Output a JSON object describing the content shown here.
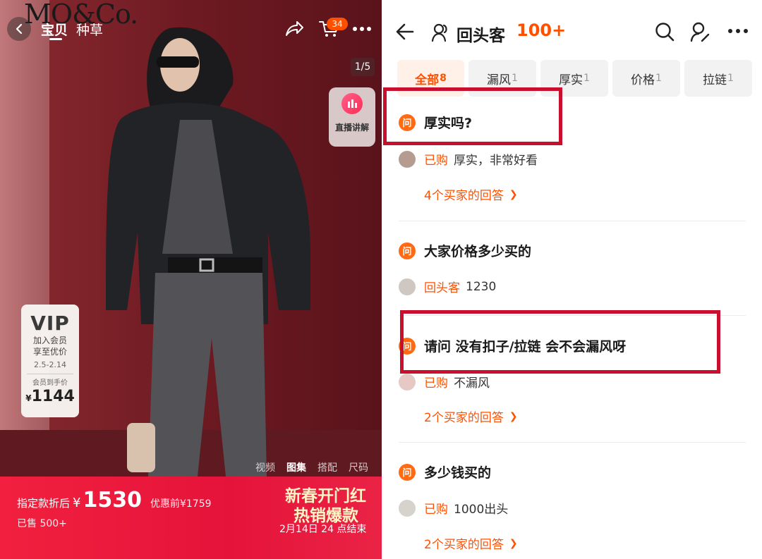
{
  "left": {
    "brand_logo": "MO&Co.",
    "nav": {
      "tab_baobei": "宝贝",
      "tab_zhongcao": "种草"
    },
    "cart_badge": "34",
    "page_counter": "1/5",
    "live": {
      "label": "直播讲解"
    },
    "vip": {
      "title": "VIP",
      "line1": "加入会员",
      "line2": "享至优价",
      "dates": "2.5-2.14",
      "member_label": "会员到手价",
      "price_symbol": "¥",
      "price": "1144"
    },
    "gallery_tabs": [
      "视频",
      "图集",
      "搭配",
      "尺码"
    ],
    "promo": {
      "label": "指定款折后",
      "yen": "¥",
      "price": "1530",
      "original": "优惠前¥1759",
      "sold": "已售 500+",
      "title1": "新春开门红",
      "title2": "热销爆款",
      "end": "2月14日 24 点结束"
    }
  },
  "right": {
    "header": {
      "title": "回头客",
      "count": "100+"
    },
    "chips": [
      {
        "label": "全部",
        "count": "8",
        "active": true
      },
      {
        "label": "漏风",
        "count": "1"
      },
      {
        "label": "厚实",
        "count": "1"
      },
      {
        "label": "价格",
        "count": "1"
      },
      {
        "label": "拉链",
        "count": "1"
      }
    ],
    "questions": [
      {
        "icon": "问",
        "text": "厚实吗?",
        "answer_tag": "已购",
        "answer": "厚实，非常好看",
        "more": "4个买家的回答"
      },
      {
        "icon": "问",
        "text": "大家价格多少买的",
        "answer_tag": "回头客",
        "answer": "1230"
      },
      {
        "icon": "问",
        "text": "请问 没有扣子/拉链 会不会漏风呀",
        "answer_tag": "已购",
        "answer": "不漏风",
        "more": "2个买家的回答"
      },
      {
        "icon": "问",
        "text": "多少钱买的",
        "answer_tag": "已购",
        "answer": "1000出头",
        "more": "2个买家的回答"
      }
    ]
  },
  "colors": {
    "accent": "#ff5000",
    "promo_red": "#e5133a",
    "highlight_box": "#c8102e"
  }
}
